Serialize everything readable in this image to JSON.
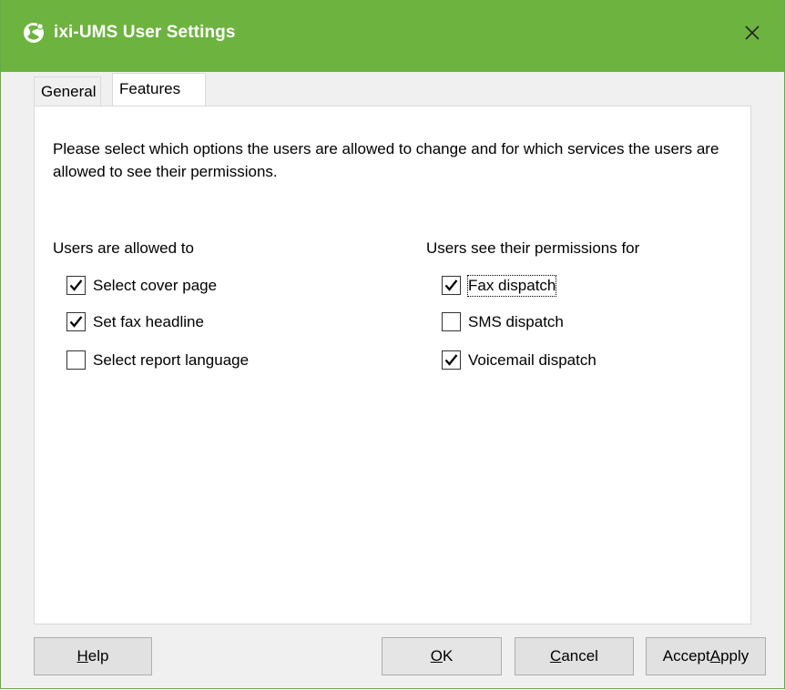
{
  "window": {
    "title": "ixi-UMS User Settings",
    "accent_color": "#6db33f"
  },
  "tabs": [
    {
      "label": "General",
      "active": false
    },
    {
      "label": "Features",
      "active": true
    }
  ],
  "panel": {
    "description": "Please select which options the users are allowed to change and for which services the users are allowed to see their permissions.",
    "left_group": {
      "label": "Users are allowed to",
      "items": [
        {
          "label": "Select cover page",
          "checked": true
        },
        {
          "label": "Set fax headline",
          "checked": true
        },
        {
          "label": "Select report language",
          "checked": false
        }
      ]
    },
    "right_group": {
      "label": "Users see their permissions for",
      "items": [
        {
          "label": "Fax dispatch",
          "checked": true,
          "focused": true
        },
        {
          "label": "SMS dispatch",
          "checked": false
        },
        {
          "label": "Voicemail dispatch",
          "checked": true
        }
      ]
    }
  },
  "buttons": {
    "help": {
      "prefix": "",
      "mnemonic": "H",
      "suffix": "elp"
    },
    "ok": {
      "prefix": "",
      "mnemonic": "O",
      "suffix": "K"
    },
    "cancel": {
      "prefix": "",
      "mnemonic": "C",
      "suffix": "ancel"
    },
    "apply": {
      "prefix": "Accept",
      "mnemonic": "A",
      "suffix": "pply"
    }
  }
}
